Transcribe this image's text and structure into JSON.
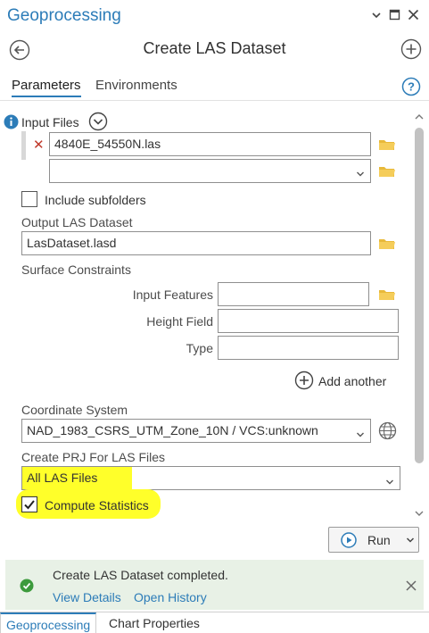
{
  "pane": {
    "title": "Geoprocessing",
    "controls": [
      "˅",
      "□",
      "✕"
    ]
  },
  "tool": {
    "title": "Create LAS Dataset"
  },
  "tabs": [
    {
      "label": "Parameters",
      "active": true
    },
    {
      "label": "Environments",
      "active": false
    }
  ],
  "params": {
    "input_files_label": "Input Files",
    "input_files": [
      "4840E_54550N.las",
      ""
    ],
    "include_subfolders_label": "Include subfolders",
    "include_subfolders_checked": false,
    "output_label": "Output LAS Dataset",
    "output_value": "LasDataset.lasd",
    "surface_constraints_label": "Surface Constraints",
    "input_features_label": "Input Features",
    "height_field_label": "Height Field",
    "type_label": "Type",
    "add_another_label": "Add another",
    "coord_sys_label": "Coordinate System",
    "coord_sys_value": "NAD_1983_CSRS_UTM_Zone_10N / VCS:unknown",
    "create_prj_label": "Create PRJ For LAS Files",
    "create_prj_value": "All LAS Files",
    "compute_stats_label": "Compute Statistics",
    "compute_stats_checked": true
  },
  "run": {
    "label": "Run"
  },
  "message": {
    "text": "Create LAS Dataset completed.",
    "view_details": "View Details",
    "open_history": "Open History"
  },
  "bottom_tabs": [
    {
      "label": "Geoprocessing",
      "active": true
    },
    {
      "label": "Chart Properties",
      "active": false
    }
  ],
  "colors": {
    "accent": "#2c7cb8",
    "highlight": "#ffff2a",
    "success": "#3c9a3c",
    "folder": "#e8b93a"
  }
}
